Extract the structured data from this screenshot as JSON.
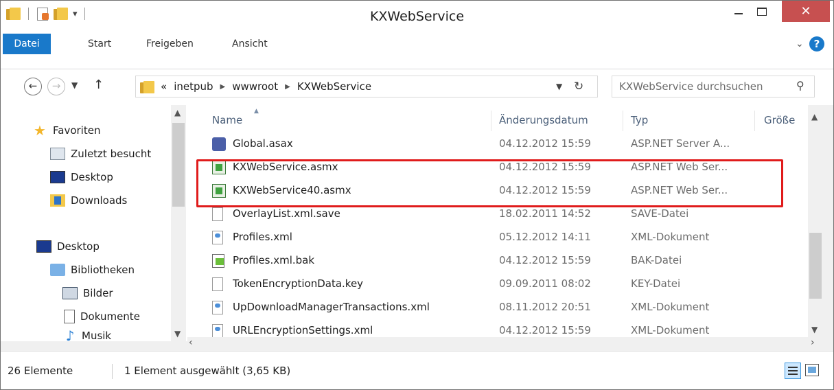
{
  "window": {
    "title": "KXWebService",
    "close_glyph": "✕",
    "accent_color": "#1979ca",
    "close_color": "#c75050",
    "highlight_color": "#e01b1b"
  },
  "ribbon": {
    "tabs": [
      "Datei",
      "Start",
      "Freigeben",
      "Ansicht"
    ],
    "help_glyph": "?"
  },
  "address": {
    "prefix": "«",
    "crumbs": [
      "inetpub",
      "wwwroot",
      "KXWebService"
    ],
    "search_placeholder": "KXWebService durchsuchen"
  },
  "sidebar": {
    "favorites": [
      {
        "label": "Favoriten",
        "icon": "star-icon"
      },
      {
        "label": "Zuletzt besucht",
        "icon": "recent-places-icon"
      },
      {
        "label": "Desktop",
        "icon": "desktop-icon"
      },
      {
        "label": "Downloads",
        "icon": "downloads-folder-icon"
      }
    ],
    "tree": [
      {
        "label": "Desktop",
        "icon": "desktop-icon"
      },
      {
        "label": "Bibliotheken",
        "icon": "libraries-icon"
      },
      {
        "label": "Bilder",
        "icon": "pictures-icon"
      },
      {
        "label": "Dokumente",
        "icon": "documents-icon"
      },
      {
        "label": "Musik",
        "icon": "music-icon"
      }
    ]
  },
  "columns": {
    "name": "Name",
    "date": "Änderungsdatum",
    "type": "Typ",
    "size": "Größe"
  },
  "files": [
    {
      "name": "Global.asax",
      "date": "04.12.2012 15:59",
      "type": "ASP.NET Server A...",
      "icon": "aspnet-server-app-icon"
    },
    {
      "name": "KXWebService.asmx",
      "date": "04.12.2012 15:59",
      "type": "ASP.NET Web Ser...",
      "icon": "aspnet-web-service-icon"
    },
    {
      "name": "KXWebService40.asmx",
      "date": "04.12.2012 15:59",
      "type": "ASP.NET Web Ser...",
      "icon": "aspnet-web-service-icon"
    },
    {
      "name": "OverlayList.xml.save",
      "date": "18.02.2011 14:52",
      "type": "SAVE-Datei",
      "icon": "blank-file-icon"
    },
    {
      "name": "Profiles.xml",
      "date": "05.12.2012 14:11",
      "type": "XML-Dokument",
      "icon": "xml-file-icon"
    },
    {
      "name": "Profiles.xml.bak",
      "date": "04.12.2012 15:59",
      "type": "BAK-Datei",
      "icon": "bak-file-icon"
    },
    {
      "name": "TokenEncryptionData.key",
      "date": "09.09.2011 08:02",
      "type": "KEY-Datei",
      "icon": "blank-file-icon"
    },
    {
      "name": "UpDownloadManagerTransactions.xml",
      "date": "08.11.2012 20:51",
      "type": "XML-Dokument",
      "icon": "xml-file-icon"
    },
    {
      "name": "URLEncryptionSettings.xml",
      "date": "04.12.2012 15:59",
      "type": "XML-Dokument",
      "icon": "xml-file-icon"
    }
  ],
  "status": {
    "count": "26 Elemente",
    "selection": "1 Element ausgewählt (3,65 KB)"
  }
}
